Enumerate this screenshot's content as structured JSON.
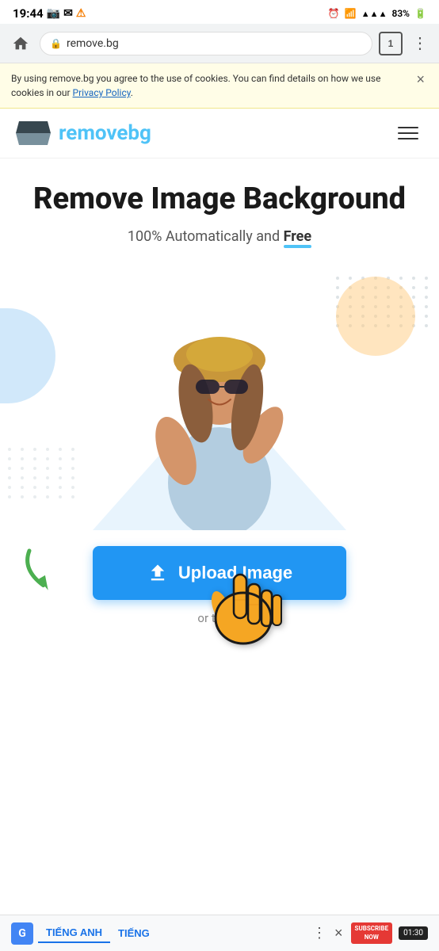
{
  "statusBar": {
    "time": "19:44",
    "batteryPercent": "83%",
    "icons": [
      "camera",
      "email",
      "warning",
      "alarm",
      "wifi",
      "signal",
      "battery"
    ]
  },
  "browserChrome": {
    "url": "remove.bg",
    "tabCount": "1",
    "homeLabel": "home",
    "menuLabel": "menu"
  },
  "cookieBanner": {
    "text": "By using remove.bg you agree to the use of cookies. You can find details on how we use cookies in our ",
    "linkText": "Privacy Policy",
    "closeLabel": "×"
  },
  "nav": {
    "logoText1": "remove",
    "logoText2": "bg",
    "menuLabel": "menu"
  },
  "hero": {
    "title": "Remove Image Background",
    "subtitlePrefix": "100% Automatically and ",
    "subtitleBold": "Free"
  },
  "upload": {
    "buttonLabel": "Upload Image",
    "orText": "or try on"
  },
  "bottomBar": {
    "gLabel": "G",
    "lang1": "TIẾNG ANH",
    "lang2": "TIẾNG",
    "moreLabel": "⋮",
    "closeLabel": "×",
    "timerText": "01:30",
    "subscribeLabel": "SUBSCRIBE\nNOW"
  }
}
